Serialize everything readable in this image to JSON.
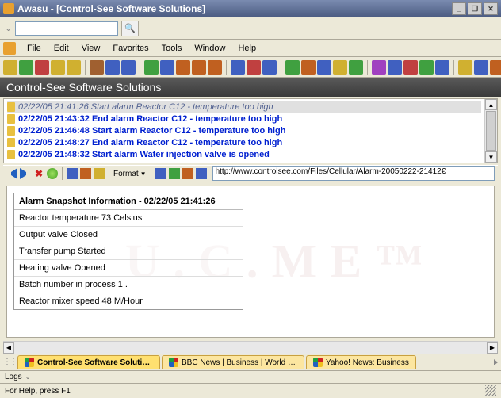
{
  "window": {
    "title": "Awasu - [Control-See Software Solutions]"
  },
  "search": {
    "value": "",
    "placeholder": ""
  },
  "menu": {
    "file": "File",
    "edit": "Edit",
    "view": "View",
    "favorites": "Favorites",
    "tools": "Tools",
    "window": "Window",
    "help": "Help"
  },
  "heading": "Control-See Software Solutions",
  "feed": {
    "selected": "02/22/05 21:41:26 Start alarm Reactor C12 - temperature too high",
    "items": [
      "02/22/05 21:43:32 End alarm Reactor C12 - temperature too high",
      "02/22/05 21:46:48 Start alarm Reactor C12 - temperature too high",
      "02/22/05 21:48:27 End alarm Reactor C12 - temperature too high",
      "02/22/05 21:48:32 Start alarm Water injection valve is opened"
    ]
  },
  "minibar": {
    "format": "Format",
    "url": "http://www.controlsee.com/Files/Cellular/Alarm-20050222-21412€"
  },
  "snapshot": {
    "title": "Alarm Snapshot Information - 02/22/05 21:41:26",
    "rows": [
      "Reactor temperature 73 Celsius",
      "Output valve Closed",
      "Transfer pump Started",
      "Heating valve Opened",
      "Batch number in process 1 .",
      "Reactor mixer speed 48 M/Hour"
    ]
  },
  "watermark": "U . C . M E ™",
  "tabs": [
    {
      "label": "Control-See Software Solutions",
      "active": true
    },
    {
      "label": "BBC News | Business | World Edition",
      "active": false
    },
    {
      "label": "Yahoo! News: Business",
      "active": false
    }
  ],
  "footer": {
    "logs": "Logs",
    "status": "For Help, press F1"
  },
  "toolbar_colors": [
    "#d0b030",
    "#40a040",
    "#c04040",
    "#d0b030",
    "#d0b030",
    "#a06030",
    "#4060c0",
    "#4060c0",
    "#40a040",
    "#4060c0",
    "#c06020",
    "#c06020",
    "#c06020",
    "#4060c0",
    "#c04040",
    "#4060c0",
    "#40a040",
    "#c06020",
    "#4060c0",
    "#d0b030",
    "#40a040",
    "#a040c0",
    "#4060c0",
    "#c04040",
    "#40a040",
    "#4060c0",
    "#d0b030",
    "#4060c0",
    "#c06020",
    "#4060c0",
    "#40a040"
  ]
}
